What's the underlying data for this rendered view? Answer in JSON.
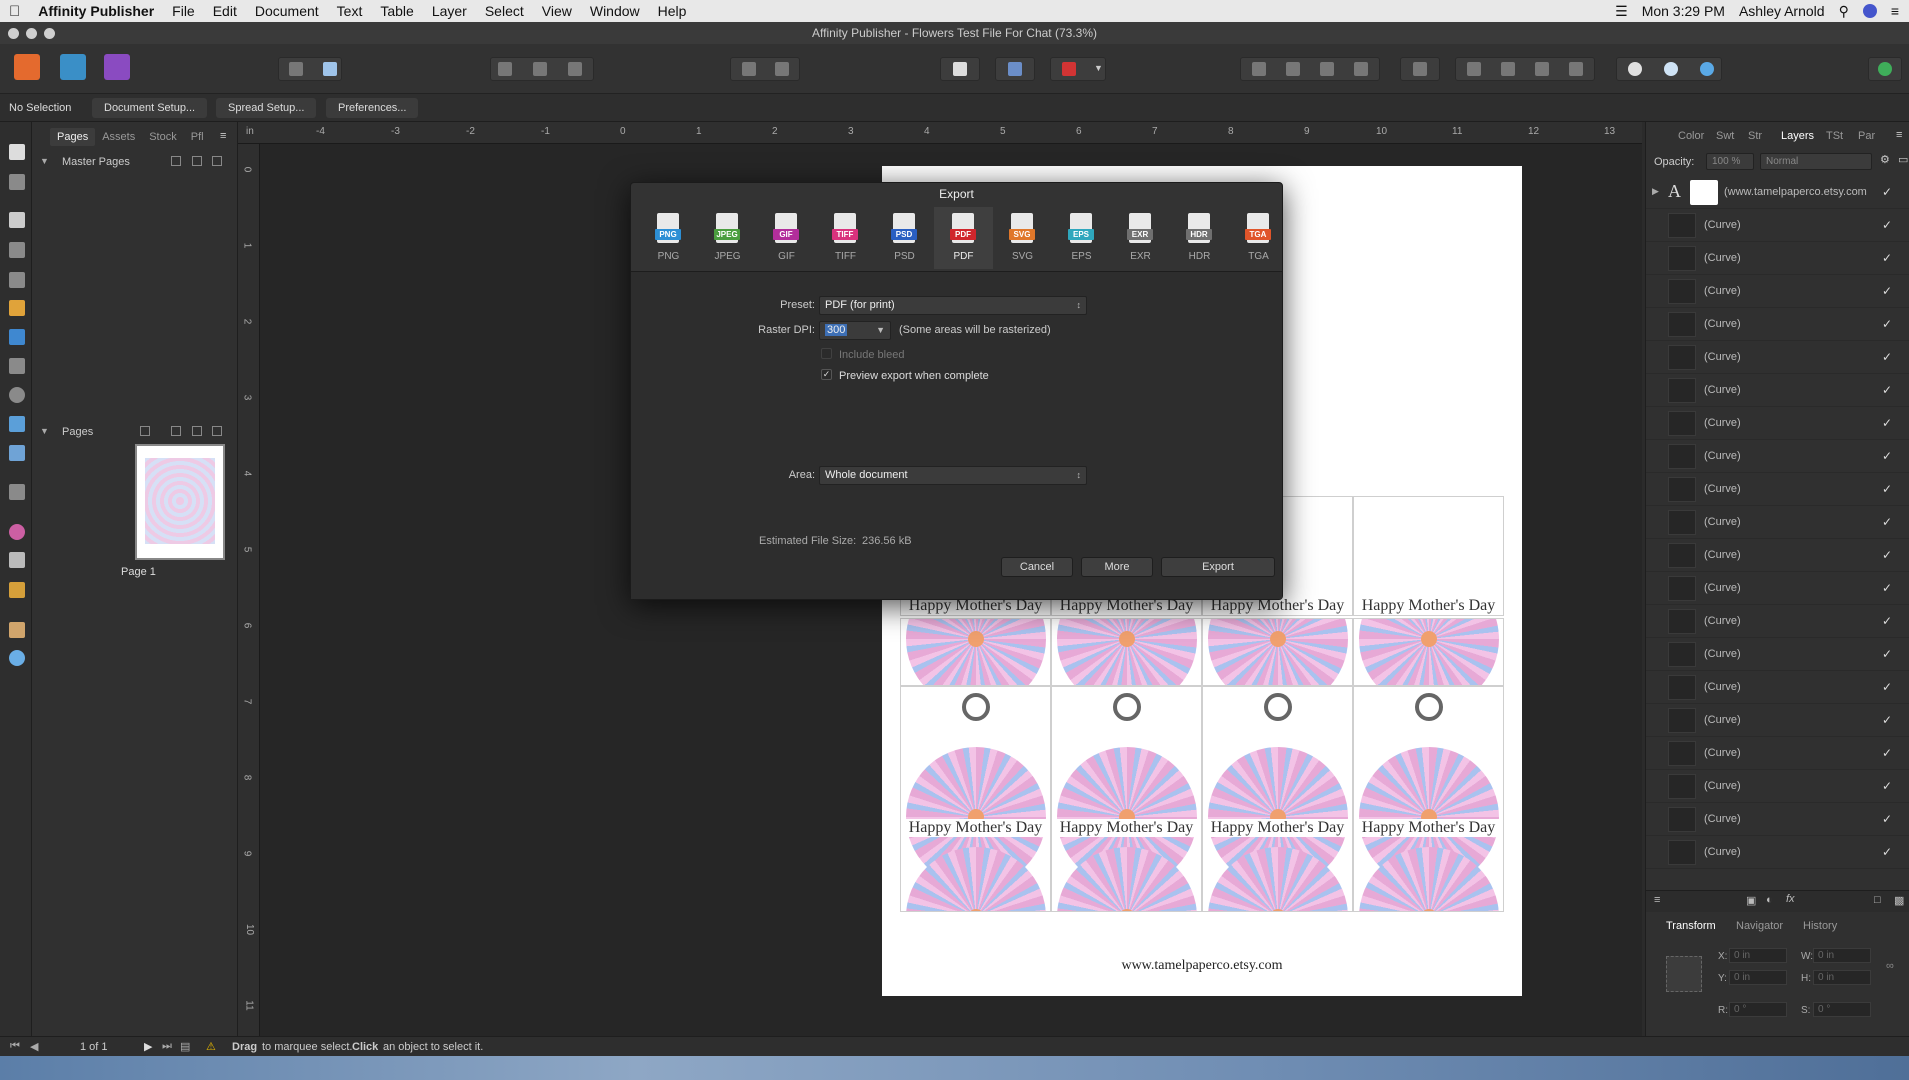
{
  "menubar": {
    "app": "Affinity Publisher",
    "items": [
      "File",
      "Edit",
      "Document",
      "Text",
      "Table",
      "Layer",
      "Select",
      "View",
      "Window",
      "Help"
    ],
    "clock": "Mon 3:29 PM",
    "user": "Ashley Arnold"
  },
  "window": {
    "title": "Affinity Publisher - Flowers Test File For Chat (73.3%)"
  },
  "context": {
    "selection": "No Selection",
    "buttons": [
      "Document Setup...",
      "Spread Setup...",
      "Preferences..."
    ]
  },
  "left_panel": {
    "tabs": [
      "Pages",
      "Assets",
      "Stock",
      "Pfl"
    ],
    "master_pages_label": "Master Pages",
    "pages_label": "Pages",
    "page_caption": "Page 1"
  },
  "ruler": {
    "unit": "in",
    "top_ticks": [
      "-4",
      "-3",
      "-2",
      "-1",
      "0",
      "1",
      "2",
      "3",
      "4",
      "5",
      "6",
      "7",
      "8",
      "9",
      "10",
      "11",
      "12",
      "13"
    ],
    "left_ticks": [
      "0",
      "1",
      "2",
      "3",
      "4",
      "5",
      "6",
      "7",
      "8",
      "9",
      "10",
      "11"
    ]
  },
  "document": {
    "tag_text": "Happy Mother's Day",
    "website": "www.tamelpaperco.etsy.com"
  },
  "export_dialog": {
    "title": "Export",
    "formats": [
      {
        "label": "PNG",
        "color": "#2d8fd5"
      },
      {
        "label": "JPEG",
        "color": "#4a9e3f"
      },
      {
        "label": "GIF",
        "color": "#b22e9b"
      },
      {
        "label": "TIFF",
        "color": "#d9327d"
      },
      {
        "label": "PSD",
        "color": "#2a5fc2"
      },
      {
        "label": "PDF",
        "color": "#d0262c"
      },
      {
        "label": "SVG",
        "color": "#e0772a"
      },
      {
        "label": "EPS",
        "color": "#2fa7bd"
      },
      {
        "label": "EXR",
        "color": "#707070"
      },
      {
        "label": "HDR",
        "color": "#707070"
      },
      {
        "label": "TGA",
        "color": "#e0552a"
      }
    ],
    "active_format": "PDF",
    "preset_label": "Preset:",
    "preset_value": "PDF (for print)",
    "raster_label": "Raster DPI:",
    "raster_value": "300",
    "raster_note": "(Some areas will be rasterized)",
    "include_bleed": "Include bleed",
    "preview_export": "Preview export when complete",
    "area_label": "Area:",
    "area_value": "Whole document",
    "size_label": "Estimated File Size:",
    "size_value": "236.56 kB",
    "cancel": "Cancel",
    "more": "More",
    "export": "Export"
  },
  "right_panel": {
    "tabs": [
      "Color",
      "Swt",
      "Str",
      "Layers",
      "TSt",
      "Par"
    ],
    "active_tab": "Layers",
    "opacity_label": "Opacity:",
    "opacity_value": "100 %",
    "blend_mode": "Normal",
    "first_layer": "(www.tamelpaperco.etsy.com",
    "layer_name": "(Curve)",
    "bottom_tabs": [
      "Transform",
      "Navigator",
      "History"
    ],
    "transform": {
      "x_label": "X:",
      "y_label": "Y:",
      "w_label": "W:",
      "h_label": "H:",
      "r_label": "R:",
      "s_label": "S:",
      "x": "0 in",
      "y": "0 in",
      "w": "0 in",
      "h": "0 in",
      "r": "0 °",
      "s": "0 °"
    }
  },
  "status": {
    "page_indicator": "1 of 1",
    "hint_bold1": "Drag",
    "hint_1": "to marquee select.",
    "hint_bold2": "Click",
    "hint_2": "an object to select it."
  }
}
